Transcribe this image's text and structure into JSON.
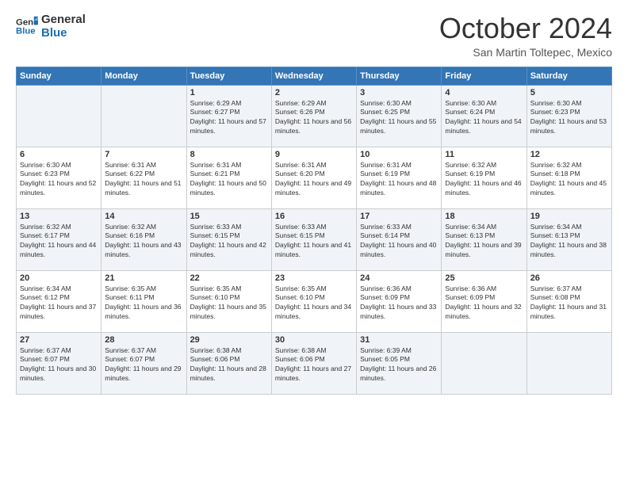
{
  "logo": {
    "line1": "General",
    "line2": "Blue"
  },
  "title": "October 2024",
  "location": "San Martin Toltepec, Mexico",
  "weekdays": [
    "Sunday",
    "Monday",
    "Tuesday",
    "Wednesday",
    "Thursday",
    "Friday",
    "Saturday"
  ],
  "weeks": [
    [
      {
        "day": "",
        "info": ""
      },
      {
        "day": "",
        "info": ""
      },
      {
        "day": "1",
        "info": "Sunrise: 6:29 AM\nSunset: 6:27 PM\nDaylight: 11 hours and 57 minutes."
      },
      {
        "day": "2",
        "info": "Sunrise: 6:29 AM\nSunset: 6:26 PM\nDaylight: 11 hours and 56 minutes."
      },
      {
        "day": "3",
        "info": "Sunrise: 6:30 AM\nSunset: 6:25 PM\nDaylight: 11 hours and 55 minutes."
      },
      {
        "day": "4",
        "info": "Sunrise: 6:30 AM\nSunset: 6:24 PM\nDaylight: 11 hours and 54 minutes."
      },
      {
        "day": "5",
        "info": "Sunrise: 6:30 AM\nSunset: 6:23 PM\nDaylight: 11 hours and 53 minutes."
      }
    ],
    [
      {
        "day": "6",
        "info": "Sunrise: 6:30 AM\nSunset: 6:23 PM\nDaylight: 11 hours and 52 minutes."
      },
      {
        "day": "7",
        "info": "Sunrise: 6:31 AM\nSunset: 6:22 PM\nDaylight: 11 hours and 51 minutes."
      },
      {
        "day": "8",
        "info": "Sunrise: 6:31 AM\nSunset: 6:21 PM\nDaylight: 11 hours and 50 minutes."
      },
      {
        "day": "9",
        "info": "Sunrise: 6:31 AM\nSunset: 6:20 PM\nDaylight: 11 hours and 49 minutes."
      },
      {
        "day": "10",
        "info": "Sunrise: 6:31 AM\nSunset: 6:19 PM\nDaylight: 11 hours and 48 minutes."
      },
      {
        "day": "11",
        "info": "Sunrise: 6:32 AM\nSunset: 6:19 PM\nDaylight: 11 hours and 46 minutes."
      },
      {
        "day": "12",
        "info": "Sunrise: 6:32 AM\nSunset: 6:18 PM\nDaylight: 11 hours and 45 minutes."
      }
    ],
    [
      {
        "day": "13",
        "info": "Sunrise: 6:32 AM\nSunset: 6:17 PM\nDaylight: 11 hours and 44 minutes."
      },
      {
        "day": "14",
        "info": "Sunrise: 6:32 AM\nSunset: 6:16 PM\nDaylight: 11 hours and 43 minutes."
      },
      {
        "day": "15",
        "info": "Sunrise: 6:33 AM\nSunset: 6:15 PM\nDaylight: 11 hours and 42 minutes."
      },
      {
        "day": "16",
        "info": "Sunrise: 6:33 AM\nSunset: 6:15 PM\nDaylight: 11 hours and 41 minutes."
      },
      {
        "day": "17",
        "info": "Sunrise: 6:33 AM\nSunset: 6:14 PM\nDaylight: 11 hours and 40 minutes."
      },
      {
        "day": "18",
        "info": "Sunrise: 6:34 AM\nSunset: 6:13 PM\nDaylight: 11 hours and 39 minutes."
      },
      {
        "day": "19",
        "info": "Sunrise: 6:34 AM\nSunset: 6:13 PM\nDaylight: 11 hours and 38 minutes."
      }
    ],
    [
      {
        "day": "20",
        "info": "Sunrise: 6:34 AM\nSunset: 6:12 PM\nDaylight: 11 hours and 37 minutes."
      },
      {
        "day": "21",
        "info": "Sunrise: 6:35 AM\nSunset: 6:11 PM\nDaylight: 11 hours and 36 minutes."
      },
      {
        "day": "22",
        "info": "Sunrise: 6:35 AM\nSunset: 6:10 PM\nDaylight: 11 hours and 35 minutes."
      },
      {
        "day": "23",
        "info": "Sunrise: 6:35 AM\nSunset: 6:10 PM\nDaylight: 11 hours and 34 minutes."
      },
      {
        "day": "24",
        "info": "Sunrise: 6:36 AM\nSunset: 6:09 PM\nDaylight: 11 hours and 33 minutes."
      },
      {
        "day": "25",
        "info": "Sunrise: 6:36 AM\nSunset: 6:09 PM\nDaylight: 11 hours and 32 minutes."
      },
      {
        "day": "26",
        "info": "Sunrise: 6:37 AM\nSunset: 6:08 PM\nDaylight: 11 hours and 31 minutes."
      }
    ],
    [
      {
        "day": "27",
        "info": "Sunrise: 6:37 AM\nSunset: 6:07 PM\nDaylight: 11 hours and 30 minutes."
      },
      {
        "day": "28",
        "info": "Sunrise: 6:37 AM\nSunset: 6:07 PM\nDaylight: 11 hours and 29 minutes."
      },
      {
        "day": "29",
        "info": "Sunrise: 6:38 AM\nSunset: 6:06 PM\nDaylight: 11 hours and 28 minutes."
      },
      {
        "day": "30",
        "info": "Sunrise: 6:38 AM\nSunset: 6:06 PM\nDaylight: 11 hours and 27 minutes."
      },
      {
        "day": "31",
        "info": "Sunrise: 6:39 AM\nSunset: 6:05 PM\nDaylight: 11 hours and 26 minutes."
      },
      {
        "day": "",
        "info": ""
      },
      {
        "day": "",
        "info": ""
      }
    ]
  ]
}
